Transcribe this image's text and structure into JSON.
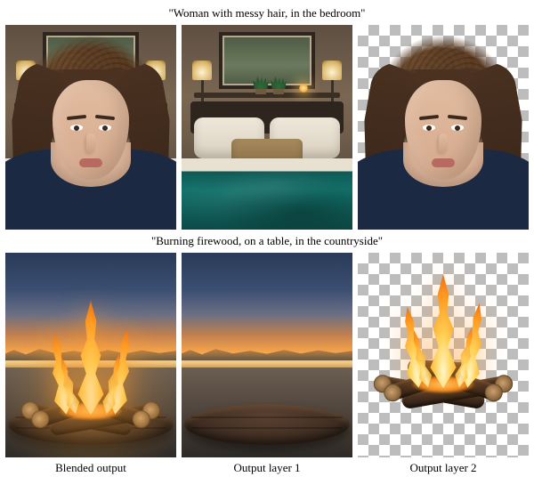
{
  "rows": [
    {
      "prompt": "\"Woman with messy hair, in the bedroom\"",
      "cells": [
        "blended",
        "background_only",
        "foreground_alpha"
      ]
    },
    {
      "prompt": "\"Burning firewood, on a table, in the countryside\"",
      "cells": [
        "blended",
        "background_only",
        "foreground_alpha"
      ]
    }
  ],
  "column_labels": [
    "Blended output",
    "Output layer 1",
    "Output layer 2"
  ]
}
